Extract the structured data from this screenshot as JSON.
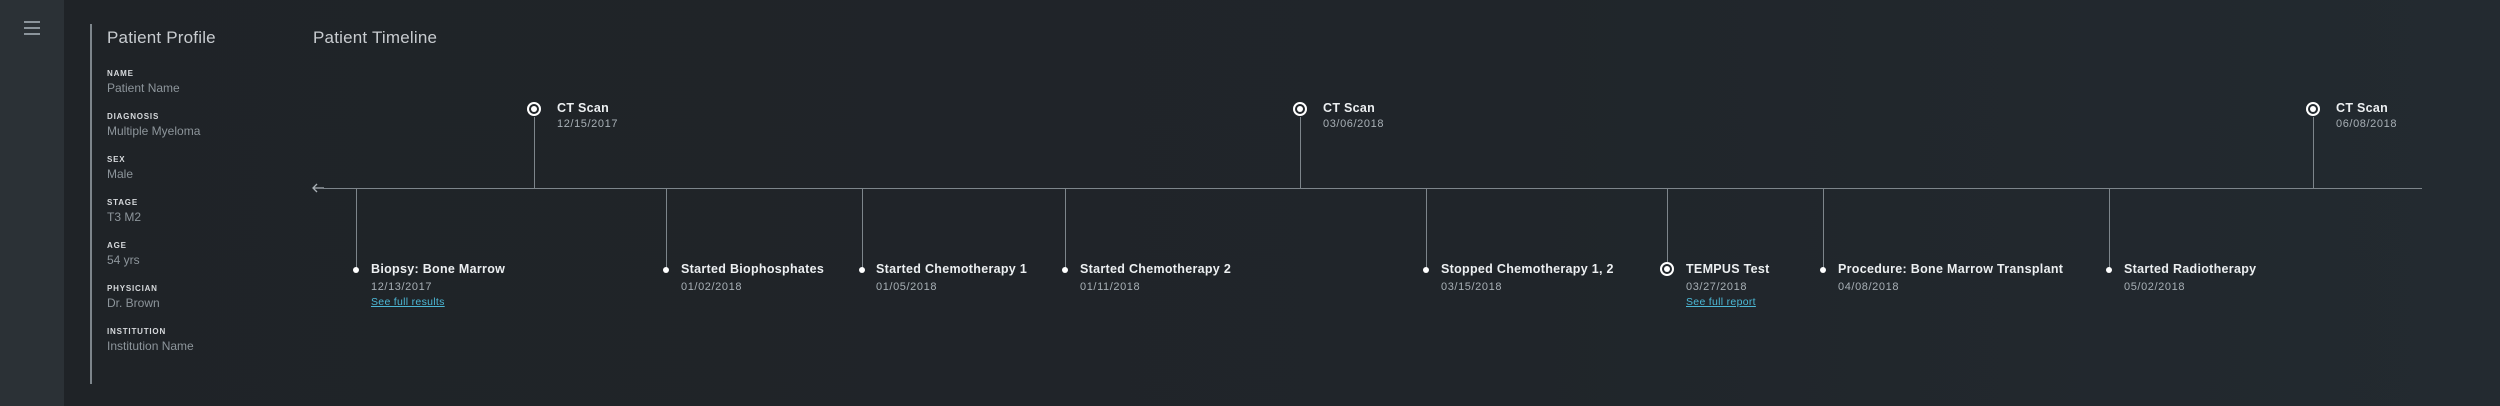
{
  "profile": {
    "title": "Patient Profile",
    "fields": [
      {
        "label": "NAME",
        "value": "Patient Name"
      },
      {
        "label": "DIAGNOSIS",
        "value": "Multiple Myeloma"
      },
      {
        "label": "SEX",
        "value": "Male"
      },
      {
        "label": "STAGE",
        "value": "T3 M2"
      },
      {
        "label": "AGE",
        "value": "54 yrs"
      },
      {
        "label": "PHYSICIAN",
        "value": "Dr. Brown"
      },
      {
        "label": "INSTITUTION",
        "value": "Institution Name"
      }
    ]
  },
  "timeline": {
    "title": "Patient Timeline",
    "events_above": [
      {
        "label": "CT Scan",
        "date": "12/15/2017"
      },
      {
        "label": "CT Scan",
        "date": "03/06/2018"
      },
      {
        "label": "CT Scan",
        "date": "06/08/2018"
      }
    ],
    "events_below": [
      {
        "label": "Biopsy: Bone Marrow",
        "date": "12/13/2017",
        "link": "See full results"
      },
      {
        "label": "Started Biophosphates",
        "date": "01/02/2018"
      },
      {
        "label": "Started Chemotherapy 1",
        "date": "01/05/2018"
      },
      {
        "label": "Started Chemotherapy 2",
        "date": "01/11/2018"
      },
      {
        "label": "Stopped Chemotherapy 1, 2",
        "date": "03/15/2018"
      },
      {
        "label": "TEMPUS Test",
        "date": "03/27/2018",
        "link": "See full report"
      },
      {
        "label": "Procedure: Bone Marrow Transplant",
        "date": "04/08/2018"
      },
      {
        "label": "Started Radiotherapy",
        "date": "05/02/2018"
      }
    ]
  },
  "icons": {
    "menu": "hamburger-menu-icon",
    "back": "arrow-left-icon",
    "event_marker": "dot-icon",
    "milestone_marker": "ring-dot-icon"
  },
  "colors": {
    "background": "#20252a",
    "rail": "#2b3136",
    "axis": "#7d858b",
    "marker": "#ffffff",
    "link": "#4cb8d6"
  }
}
